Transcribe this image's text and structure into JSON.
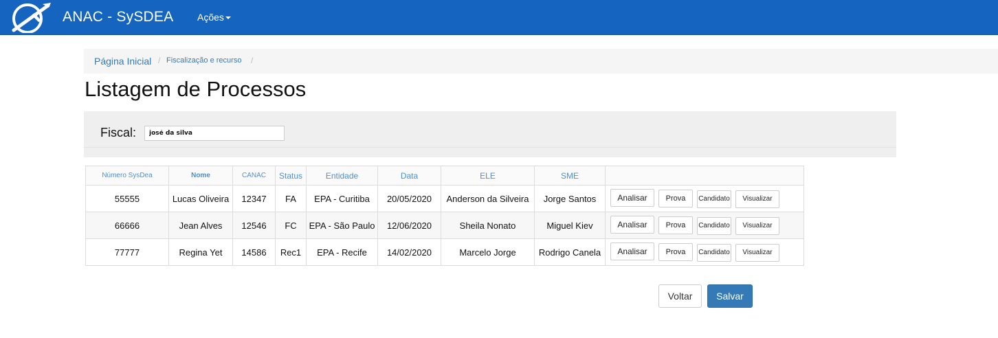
{
  "navbar": {
    "brand": "ANAC - SySDEA",
    "menu_acoes": "Ações"
  },
  "breadcrumb": {
    "home": "Página Inicial",
    "fiscalizacao": "Fiscalização e recurso",
    "separator": "/"
  },
  "page": {
    "title": "Listagem de Processos"
  },
  "filter": {
    "fiscal_label": "Fiscal:",
    "fiscal_value": "josé da silva"
  },
  "table": {
    "headers": [
      "Número SysDea",
      "Nome",
      "CANAC",
      "Status",
      "Entidade",
      "Data",
      "ELE",
      "SME",
      ""
    ],
    "rows": [
      {
        "numero": "55555",
        "nome": "Lucas Oliveira",
        "canac": "12347",
        "status": "FA",
        "entidade": "EPA - Curitiba",
        "data": "20/05/2020",
        "ele": "Anderson da Silveira",
        "sme": "Jorge Santos"
      },
      {
        "numero": "66666",
        "nome": "Jean Alves",
        "canac": "12546",
        "status": "FC",
        "entidade": "EPA - São Paulo",
        "data": "12/06/2020",
        "ele": "Sheila Nonato",
        "sme": "Miguel Kiev"
      },
      {
        "numero": "77777",
        "nome": "Regina Yet",
        "canac": "14586",
        "status": "Rec1",
        "entidade": "EPA - Recife",
        "data": "14/02/2020",
        "ele": "Marcelo Jorge",
        "sme": "Rodrigo Canela"
      }
    ],
    "actions": {
      "analisar": "Analisar",
      "prova": "Prova",
      "candidato": "Candidato",
      "visualizar": "Visualizar"
    }
  },
  "footer": {
    "voltar": "Voltar",
    "salvar": "Salvar"
  },
  "colors": {
    "navbar": "#1565c0",
    "link": "#337ab7",
    "primary_button": "#337ab7"
  },
  "icons": {
    "logo": "airplane-logo-icon",
    "caret": "caret-down-icon"
  }
}
